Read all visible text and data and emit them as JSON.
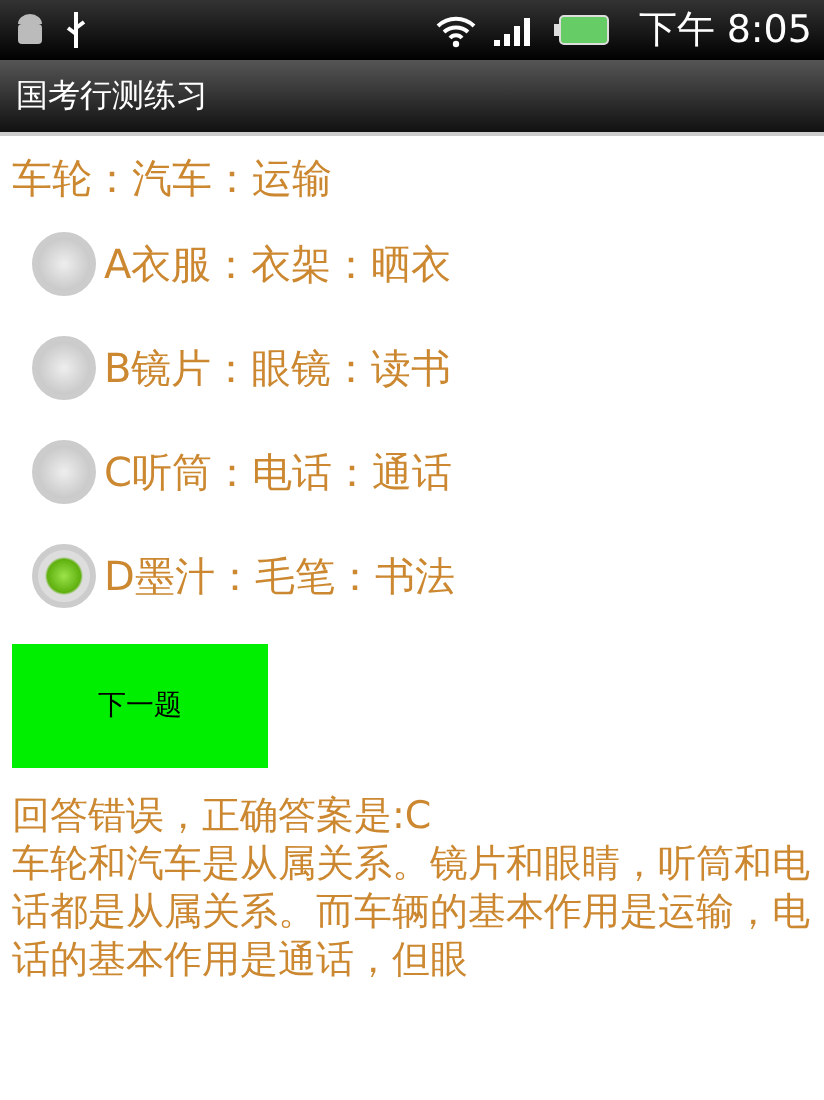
{
  "status_bar": {
    "time": "下午 8:05"
  },
  "title_bar": {
    "title": "国考行测练习"
  },
  "question": "车轮：汽车：运输",
  "options": [
    {
      "label": "A衣服：衣架：晒衣",
      "selected": false
    },
    {
      "label": "B镜片：眼镜：读书",
      "selected": false
    },
    {
      "label": "C听筒：电话：通话",
      "selected": false
    },
    {
      "label": "D墨汁：毛笔：书法",
      "selected": true
    }
  ],
  "next_button": "下一题",
  "result": "回答错误，正确答案是:C",
  "explanation": "车轮和汽车是从属关系。镜片和眼睛，听筒和电话都是从属关系。而车辆的基本作用是运输，电话的基本作用是通话，但眼"
}
